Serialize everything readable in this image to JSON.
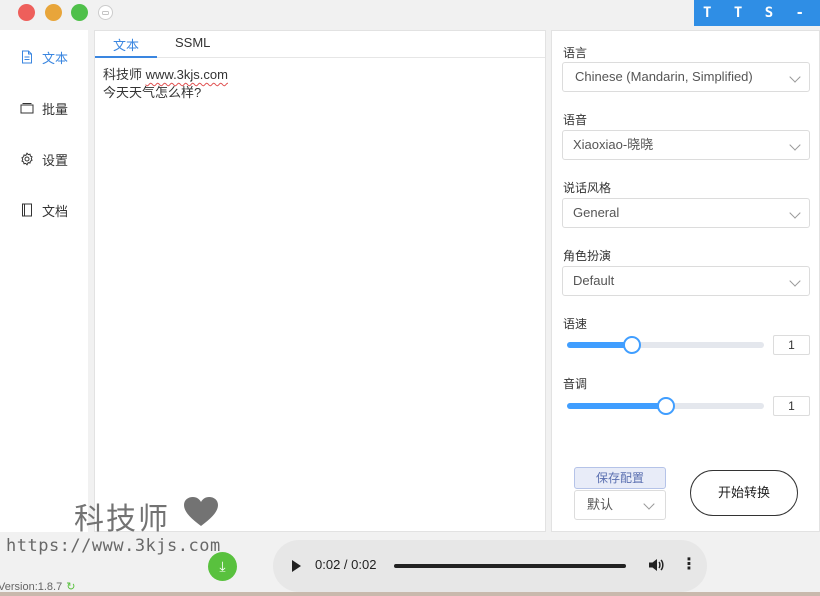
{
  "brand": "T T S - V U E",
  "sidebar": {
    "items": [
      {
        "label": "文本",
        "icon": "document-icon"
      },
      {
        "label": "批量",
        "icon": "folder-icon"
      },
      {
        "label": "设置",
        "icon": "gear-icon"
      },
      {
        "label": "文档",
        "icon": "book-icon"
      }
    ],
    "active": 0
  },
  "editor": {
    "tabs": [
      "文本",
      "SSML"
    ],
    "active_tab": 0,
    "line1_prefix": "科技师 ",
    "line1_url": "www.3kjs.com",
    "line2": "今天天气怎么样?"
  },
  "settings": {
    "language_label": "语言",
    "language_value": "Chinese (Mandarin, Simplified)",
    "voice_label": "语音",
    "voice_value": "Xiaoxiao-晓晓",
    "style_label": "说话风格",
    "style_value": "General",
    "role_label": "角色扮演",
    "role_value": "Default",
    "speed_label": "语速",
    "speed_value": "1",
    "speed_fraction": 0.33,
    "pitch_label": "音调",
    "pitch_value": "1",
    "pitch_fraction": 0.5,
    "save_config_label": "保存配置",
    "config_value": "默认",
    "start_label": "开始转换"
  },
  "player": {
    "time": "0:02 / 0:02",
    "progress_fraction": 1.0
  },
  "version": "Version:1.8.7",
  "watermark": {
    "title": "科技师",
    "url": "https://www.3kjs.com"
  },
  "colors": {
    "accent": "#3a86e0",
    "brand_bg": "#2f8ee5",
    "slider": "#409eff",
    "download": "#59c13e"
  }
}
